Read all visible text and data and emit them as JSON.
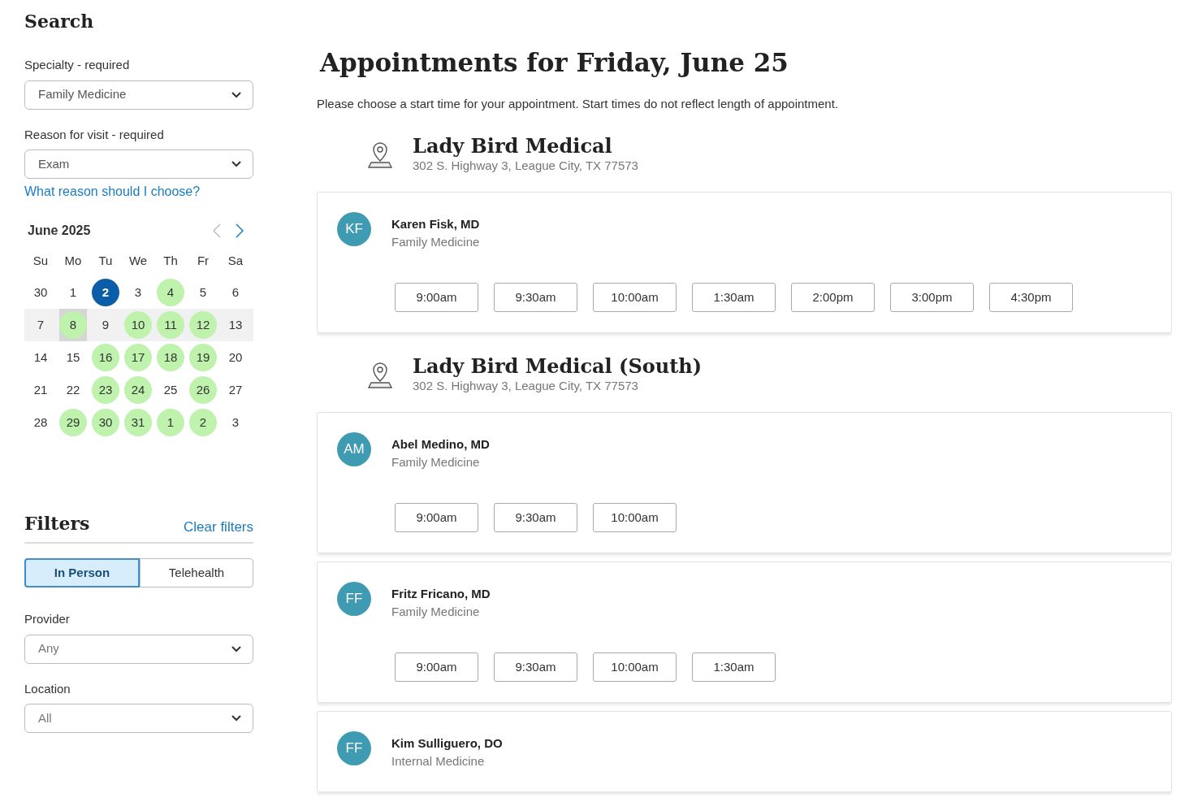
{
  "search": {
    "title": "Search",
    "fields": [
      {
        "label": "Specialty - required",
        "value": "Family Medicine"
      },
      {
        "label": "Reason for visit  - required",
        "value": "Exam"
      }
    ],
    "help_link": "What reason should I choose?"
  },
  "calendar": {
    "month": "June 2025",
    "prev_disabled": true,
    "next_disabled": false,
    "weekdays": [
      "Su",
      "Mo",
      "Tu",
      "We",
      "Th",
      "Fr",
      "Sa"
    ],
    "weeks": [
      {
        "highlighted": false,
        "days": [
          {
            "label": "30",
            "available": false,
            "selected": false,
            "focused": false
          },
          {
            "label": "1",
            "available": false,
            "selected": false,
            "focused": false
          },
          {
            "label": "2",
            "available": false,
            "selected": true,
            "focused": false
          },
          {
            "label": "3",
            "available": false,
            "selected": false,
            "focused": false
          },
          {
            "label": "4",
            "available": true,
            "selected": false,
            "focused": false
          },
          {
            "label": "5",
            "available": false,
            "selected": false,
            "focused": false
          },
          {
            "label": "6",
            "available": false,
            "selected": false,
            "focused": false
          }
        ]
      },
      {
        "highlighted": true,
        "days": [
          {
            "label": "7",
            "available": false,
            "selected": false,
            "focused": false
          },
          {
            "label": "8",
            "available": true,
            "selected": false,
            "focused": true
          },
          {
            "label": "9",
            "available": false,
            "selected": false,
            "focused": false
          },
          {
            "label": "10",
            "available": true,
            "selected": false,
            "focused": false
          },
          {
            "label": "11",
            "available": true,
            "selected": false,
            "focused": false
          },
          {
            "label": "12",
            "available": true,
            "selected": false,
            "focused": false
          },
          {
            "label": "13",
            "available": false,
            "selected": false,
            "focused": false
          }
        ]
      },
      {
        "highlighted": false,
        "days": [
          {
            "label": "14",
            "available": false,
            "selected": false,
            "focused": false
          },
          {
            "label": "15",
            "available": false,
            "selected": false,
            "focused": false
          },
          {
            "label": "16",
            "available": true,
            "selected": false,
            "focused": false
          },
          {
            "label": "17",
            "available": true,
            "selected": false,
            "focused": false
          },
          {
            "label": "18",
            "available": true,
            "selected": false,
            "focused": false
          },
          {
            "label": "19",
            "available": true,
            "selected": false,
            "focused": false
          },
          {
            "label": "20",
            "available": false,
            "selected": false,
            "focused": false
          }
        ]
      },
      {
        "highlighted": false,
        "days": [
          {
            "label": "21",
            "available": false,
            "selected": false,
            "focused": false
          },
          {
            "label": "22",
            "available": false,
            "selected": false,
            "focused": false
          },
          {
            "label": "23",
            "available": true,
            "selected": false,
            "focused": false
          },
          {
            "label": "24",
            "available": true,
            "selected": false,
            "focused": false
          },
          {
            "label": "25",
            "available": false,
            "selected": false,
            "focused": false
          },
          {
            "label": "26",
            "available": true,
            "selected": false,
            "focused": false
          },
          {
            "label": "27",
            "available": false,
            "selected": false,
            "focused": false
          }
        ]
      },
      {
        "highlighted": false,
        "days": [
          {
            "label": "28",
            "available": false,
            "selected": false,
            "focused": false
          },
          {
            "label": "29",
            "available": true,
            "selected": false,
            "focused": false
          },
          {
            "label": "30",
            "available": true,
            "selected": false,
            "focused": false
          },
          {
            "label": "31",
            "available": true,
            "selected": false,
            "focused": false
          },
          {
            "label": "1",
            "available": true,
            "selected": false,
            "focused": false
          },
          {
            "label": "2",
            "available": true,
            "selected": false,
            "focused": false
          },
          {
            "label": "3",
            "available": false,
            "selected": false,
            "focused": false
          }
        ]
      }
    ]
  },
  "filters": {
    "title": "Filters",
    "clear_link": "Clear filters",
    "visit_types": [
      {
        "label": "In Person",
        "selected": true
      },
      {
        "label": "Telehealth",
        "selected": false
      }
    ],
    "fields": [
      {
        "label": "Provider",
        "placeholder": "Any"
      },
      {
        "label": "Location",
        "placeholder": "All"
      }
    ]
  },
  "main": {
    "title": "Appointments for Friday, June 25",
    "intro": "Please choose a start time for your appointment. Start times do not reflect length of appointment.",
    "locations": [
      {
        "name": "Lady Bird Medical",
        "address": "302 S. Highway 3, League City, TX 77573",
        "providers": [
          {
            "initials": "KF",
            "name": "Karen Fisk, MD",
            "specialty": "Family Medicine",
            "slots": [
              "9:00am",
              "9:30am",
              "10:00am",
              "1:30am",
              "2:00pm",
              "3:00pm",
              "4:30pm"
            ]
          }
        ]
      },
      {
        "name": "Lady Bird Medical (South)",
        "address": "302 S. Highway 3, League City, TX 77573",
        "providers": [
          {
            "initials": "AM",
            "name": "Abel Medino, MD",
            "specialty": "Family Medicine",
            "slots": [
              "9:00am",
              "9:30am",
              "10:00am"
            ]
          },
          {
            "initials": "FF",
            "name": "Fritz Fricano, MD",
            "specialty": "Family Medicine",
            "slots": [
              "9:00am",
              "9:30am",
              "10:00am",
              "1:30am"
            ]
          },
          {
            "initials": "FF",
            "name": "Kim Sulliguero, DO",
            "specialty": "Internal Medicine"
          }
        ]
      }
    ]
  }
}
